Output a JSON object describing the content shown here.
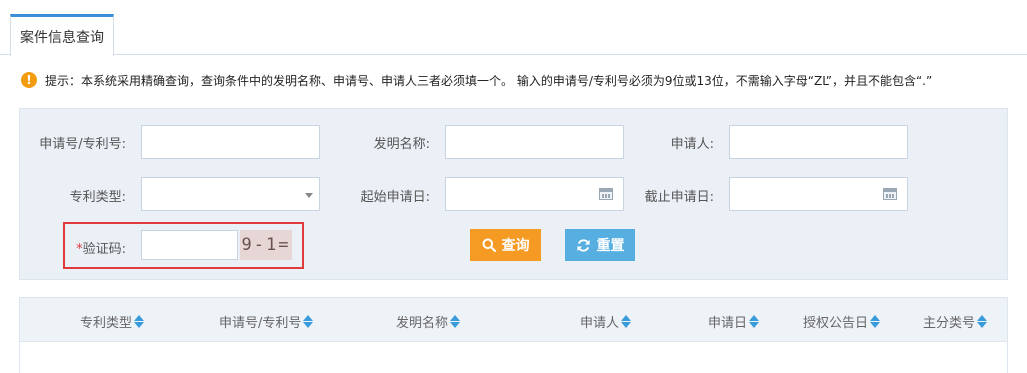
{
  "tab": {
    "label": "案件信息查询"
  },
  "tip": {
    "icon": "exclamation-icon",
    "text": "提示：本系统采用精确查询，查询条件中的发明名称、申请号、申请人三者必须填一个。 输入的申请号/专利号必须为9位或13位，不需输入字母“ZL”，并且不能包含“.”"
  },
  "form": {
    "app_number_label": "申请号/专利号:",
    "app_number_value": "",
    "invention_name_label": "发明名称:",
    "invention_name_value": "",
    "applicant_label": "申请人:",
    "applicant_value": "",
    "patent_type_label": "专利类型:",
    "patent_type_value": "",
    "start_date_label": "起始申请日:",
    "start_date_value": "",
    "end_date_label": "截止申请日:",
    "end_date_value": "",
    "captcha_star": "*",
    "captcha_label": "验证码:",
    "captcha_value": "",
    "captcha_image_text": "9-1="
  },
  "buttons": {
    "search_label": "查询",
    "reset_label": "重置"
  },
  "table": {
    "columns": [
      "专利类型",
      "申请号/专利号",
      "发明名称",
      "申请人",
      "申请日",
      "授权公告日",
      "主分类号"
    ]
  },
  "colors": {
    "accent": "#3a8fd6",
    "search_button": "#f59a23",
    "reset_button": "#57aee0",
    "highlight_border": "#e03a3a",
    "warning_icon": "#f39c12"
  }
}
